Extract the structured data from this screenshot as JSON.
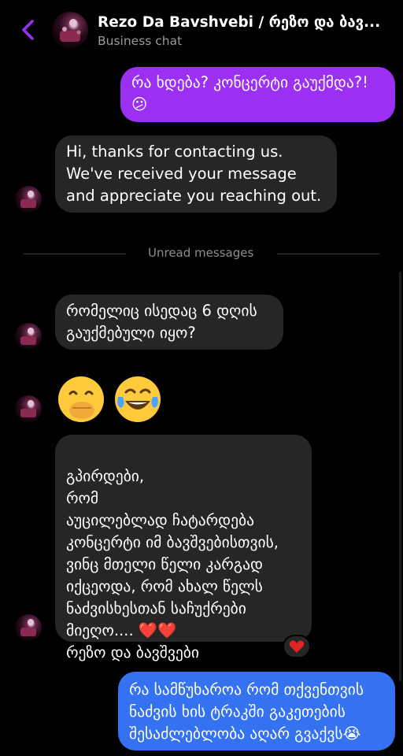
{
  "header": {
    "title": "Rezo Da Bavshvebi / რეზო და ბავ...",
    "subtitle": "Business chat"
  },
  "messages": [
    {
      "text": "რა ხდება? კონცერტი გაუქმდა?! 😕"
    },
    {
      "text": "Hi, thanks for contacting us. We've received your message and appreciate you reaching out."
    },
    {
      "text": "რომელიც ისედაც 6 დღის გაუქმებული იყო?"
    },
    {
      "text": "🤭😂"
    },
    {
      "text": "გპირდები,\nრომ\nაუცილებლად ჩატარდება კონცერტი იმ ბავშვებისთვის, ვინც მთელი წელი კარგად იქცეოდა, რომ ახალ წელს ნაძვისხესთან საჩუქრები მიეღო.... ❤️❤️\nრეზო და ბავშვები"
    },
    {
      "text": "რა სამწუხაროა რომ თქვენთვის ნაძვის ხის ტრაკში გაკეთების შესაძლებლობა აღარ გვაქვს😭"
    }
  ],
  "separator": {
    "label": "Unread messages"
  },
  "reaction": {
    "emoji": "❤️"
  },
  "icons": {
    "back": "chevron-left-icon",
    "avatar": "page-avatar"
  },
  "colors": {
    "accent": "#9b2ff2",
    "outgoing_blue": "#3472f2",
    "incoming": "#262626"
  }
}
